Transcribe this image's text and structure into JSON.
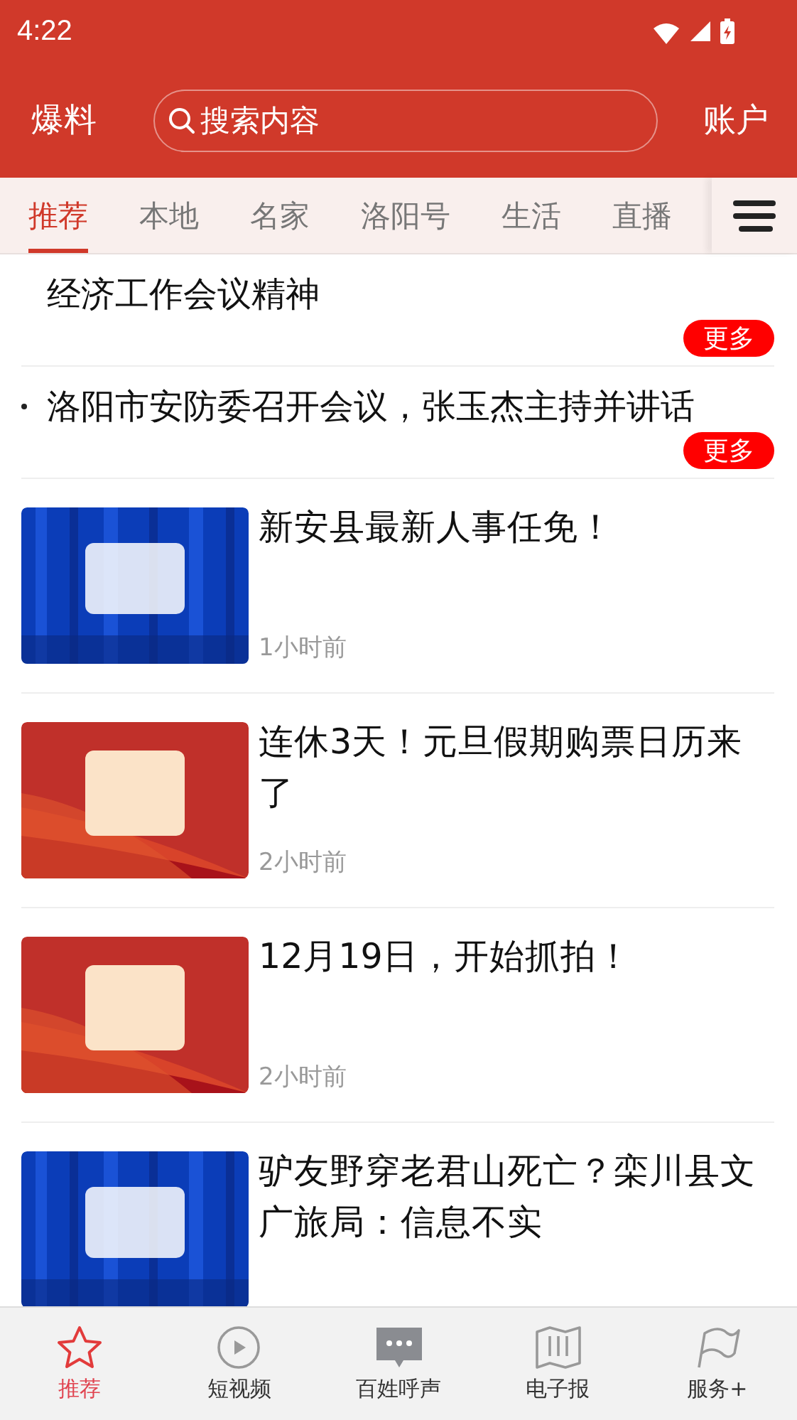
{
  "status_bar": {
    "time": "4:22"
  },
  "header": {
    "left": "爆料",
    "search": {
      "placeholder": "搜索内容"
    },
    "right": "账户"
  },
  "tabs": [
    {
      "label": "推荐",
      "selected": true
    },
    {
      "label": "本地",
      "selected": false
    },
    {
      "label": "名家",
      "selected": false
    },
    {
      "label": "洛阳号",
      "selected": false
    },
    {
      "label": "生活",
      "selected": false
    },
    {
      "label": "直播",
      "selected": false
    }
  ],
  "feed": [
    {
      "kind": "text",
      "title": "经济工作会议精神",
      "bullet": false,
      "more": "更多"
    },
    {
      "kind": "text",
      "title": "洛阳市安防委召开会议，张玉杰主持并讲话",
      "bullet": true,
      "more": "更多"
    },
    {
      "title": "新安县最新人事任免！",
      "time": "1小时前"
    },
    {
      "title": "连休3天！元旦假期购票日历来了",
      "time": "2小时前"
    },
    {
      "title": "12月19日，开始抓拍！",
      "time": "2小时前"
    },
    {
      "title": "驴友野穿老君山死亡？栾川县文广旅局：信息不实"
    }
  ],
  "bottom_nav": [
    {
      "label": "推荐",
      "selected": true
    },
    {
      "label": "短视频",
      "selected": false
    },
    {
      "label": "百姓呼声",
      "selected": false
    },
    {
      "label": "电子报",
      "selected": false
    },
    {
      "label": "服务+",
      "selected": false
    }
  ]
}
